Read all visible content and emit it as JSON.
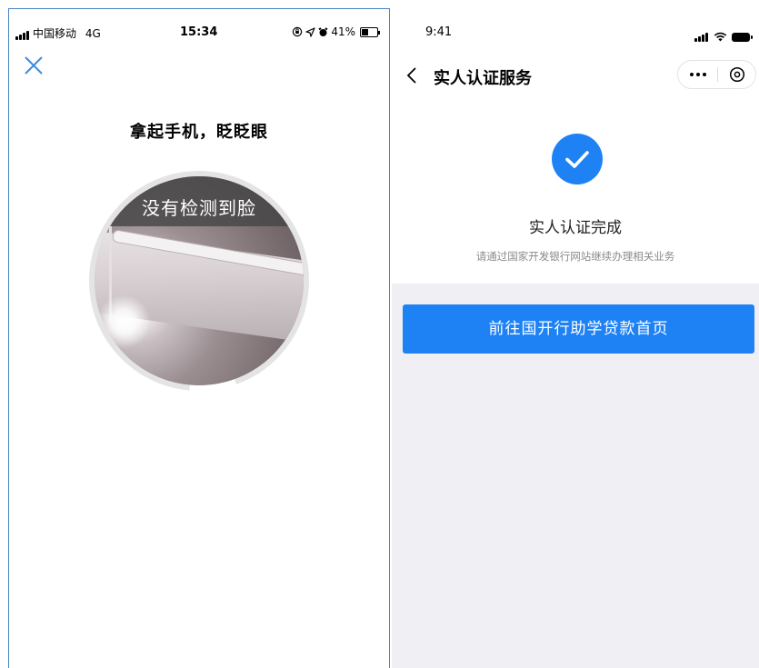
{
  "left_screen": {
    "status_bar": {
      "carrier": "中国移动",
      "network": "4G",
      "time": "15:34",
      "battery": "41%"
    },
    "prompt": "拿起手机，眨眨眼",
    "camera_banner": "没有检测到脸",
    "icons": {
      "close": "close-icon",
      "alarm": "alarm-icon",
      "location": "location-icon",
      "lock": "orientation-lock-icon"
    }
  },
  "right_screen": {
    "status_bar": {
      "time": "9:41"
    },
    "nav": {
      "title": "实人认证服务"
    },
    "result": {
      "title": "实人认证完成",
      "subtitle": "请通过国家开发银行网站继续办理相关业务"
    },
    "action_button": "前往国开行助学贷款首页",
    "colors": {
      "accent": "#1e82f5",
      "page_background": "#efeff4"
    }
  }
}
